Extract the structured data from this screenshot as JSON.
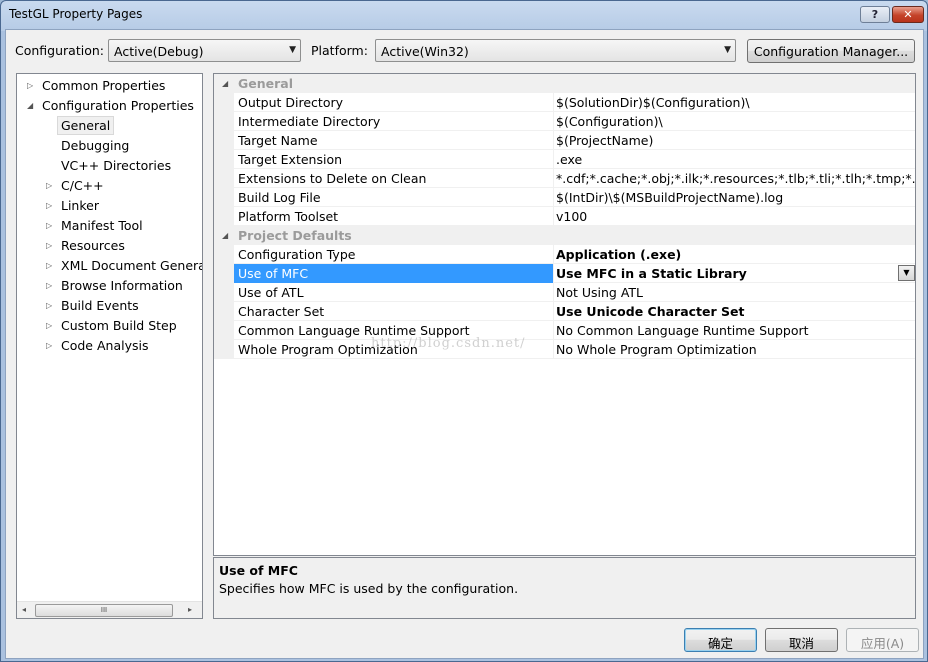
{
  "window": {
    "title": "TestGL Property Pages",
    "help_glyph": "?",
    "close_glyph": "✕"
  },
  "toolbar": {
    "configuration_label": "Configuration:",
    "configuration_value": "Active(Debug)",
    "platform_label": "Platform:",
    "platform_value": "Active(Win32)",
    "config_manager_label": "Configuration Manager..."
  },
  "tree": {
    "items": [
      {
        "label": "Common Properties",
        "expander": "▷"
      },
      {
        "label": "Configuration Properties",
        "expander": "◢"
      },
      {
        "label": "General",
        "expander": ""
      },
      {
        "label": "Debugging",
        "expander": ""
      },
      {
        "label": "VC++ Directories",
        "expander": ""
      },
      {
        "label": "C/C++",
        "expander": "▷"
      },
      {
        "label": "Linker",
        "expander": "▷"
      },
      {
        "label": "Manifest Tool",
        "expander": "▷"
      },
      {
        "label": "Resources",
        "expander": "▷"
      },
      {
        "label": "XML Document Generat",
        "expander": "▷"
      },
      {
        "label": "Browse Information",
        "expander": "▷"
      },
      {
        "label": "Build Events",
        "expander": "▷"
      },
      {
        "label": "Custom Build Step",
        "expander": "▷"
      },
      {
        "label": "Code Analysis",
        "expander": "▷"
      }
    ],
    "scroll_left": "◂",
    "scroll_right": "▸",
    "scroll_grip": "III"
  },
  "grid": {
    "categories": [
      {
        "label": "General",
        "expander": "◢"
      },
      {
        "label": "Project Defaults",
        "expander": "◢"
      }
    ],
    "general_rows": [
      {
        "name": "Output Directory",
        "value": "$(SolutionDir)$(Configuration)\\"
      },
      {
        "name": "Intermediate Directory",
        "value": "$(Configuration)\\"
      },
      {
        "name": "Target Name",
        "value": "$(ProjectName)"
      },
      {
        "name": "Target Extension",
        "value": ".exe"
      },
      {
        "name": "Extensions to Delete on Clean",
        "value": "*.cdf;*.cache;*.obj;*.ilk;*.resources;*.tlb;*.tli;*.tlh;*.tmp;*.rsp;*.pgc"
      },
      {
        "name": "Build Log File",
        "value": "$(IntDir)\\$(MSBuildProjectName).log"
      },
      {
        "name": "Platform Toolset",
        "value": "v100"
      }
    ],
    "defaults_rows": [
      {
        "name": "Configuration Type",
        "value": "Application (.exe)"
      },
      {
        "name": "Use of MFC",
        "value": "Use MFC in a Static Library"
      },
      {
        "name": "Use of ATL",
        "value": "Not Using ATL"
      },
      {
        "name": "Character Set",
        "value": "Use Unicode Character Set"
      },
      {
        "name": "Common Language Runtime Support",
        "value": "No Common Language Runtime Support"
      },
      {
        "name": "Whole Program Optimization",
        "value": "No Whole Program Optimization"
      }
    ],
    "dropdown_glyph": "▼",
    "watermark": "http://blog.csdn.net/"
  },
  "description": {
    "title": "Use of MFC",
    "text": "Specifies how MFC is used by the configuration."
  },
  "buttons": {
    "ok": "确定",
    "cancel": "取消",
    "apply": "应用(A)"
  },
  "colors": {
    "selection": "#3399ff",
    "category_text": "#9b9b9b"
  }
}
